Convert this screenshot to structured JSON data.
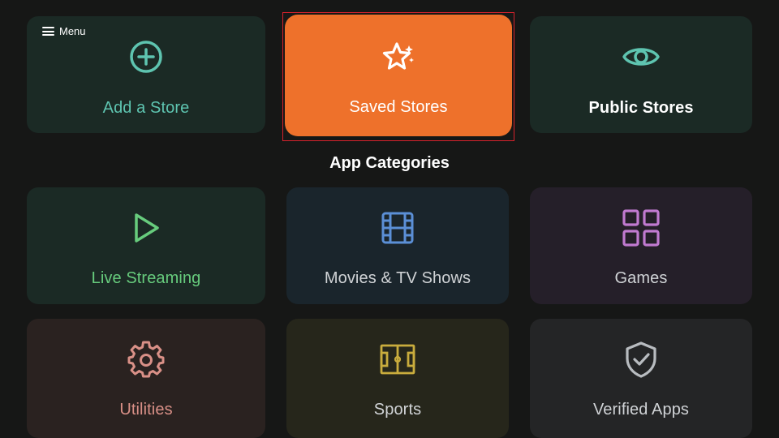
{
  "menu": {
    "label": "Menu",
    "icon": "menu-icon"
  },
  "top_tiles": [
    {
      "label": "Add a Store",
      "icon": "add-circle-icon",
      "color": "#5ec4b0"
    },
    {
      "label": "Saved Stores",
      "icon": "stars-icon",
      "color": "#ffffff"
    },
    {
      "label": "Public Stores",
      "icon": "eye-icon",
      "color": "#ffffff"
    }
  ],
  "section": {
    "title": "App Categories"
  },
  "categories": [
    {
      "label": "Live Streaming",
      "icon": "play-icon",
      "color": "#67cc7d"
    },
    {
      "label": "Movies & TV Shows",
      "icon": "film-icon",
      "color": "#d0d3d6"
    },
    {
      "label": "Games",
      "icon": "grid-icon",
      "color": "#d0d3d6"
    },
    {
      "label": "Utilities",
      "icon": "gear-icon",
      "color": "#d99087"
    },
    {
      "label": "Sports",
      "icon": "soccer-field-icon",
      "color": "#d0d3d6"
    },
    {
      "label": "Verified Apps",
      "icon": "shield-check-icon",
      "color": "#d0d3d6"
    }
  ],
  "colors": {
    "background": "#161716",
    "selected_tile": "#ee712b",
    "focus_border": "#d7222c",
    "accent_teal": "#5ec4b0"
  }
}
